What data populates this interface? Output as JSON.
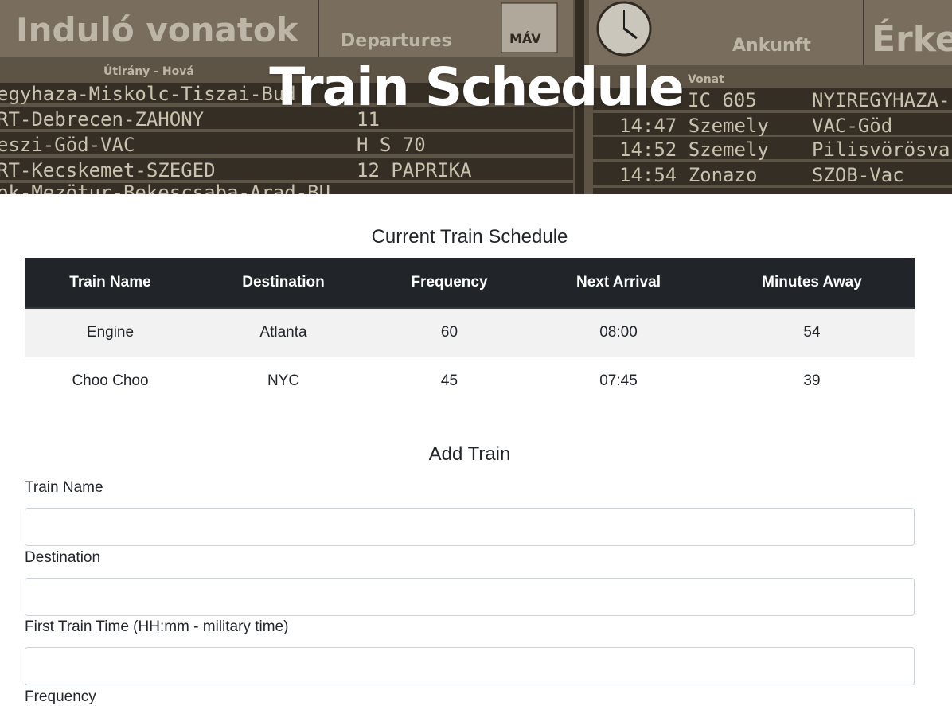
{
  "header": {
    "title": "Train Schedule",
    "board_texts": {
      "top_left_1": "Induló vonatok",
      "top_left_2": "Departures",
      "logo": "MÁV",
      "top_right_1": "Ankunft",
      "top_right_2": "Érkez",
      "sub_1": "Útirány - Hová",
      "sub_2": "Vonat",
      "row_l1": "egyhaza-Miskolc-Tiszai-Bud",
      "row_l2": "RT-Debrecen-ZAHONY",
      "row_l3": "eszi-Göd-VAC",
      "row_l4": "RT-Kecskemet-SZEGED",
      "row_l5": "ok-Mezötur-Bekescsaba-Arad-BU",
      "row_m2": "11",
      "row_m3": "H   S 70",
      "row_m4": "12  PAPRIKA",
      "row_r1": "IC 605",
      "row_r1b": "NYIREGYHAZA-",
      "row_r2": "14:47 Szemely",
      "row_r2b": "VAC-Göd",
      "row_r3": "14:52 Szemely",
      "row_r3b": "Pilisvörösvar",
      "row_r4": "14:54 Zonazo",
      "row_r4b": "SZOB-Vac"
    }
  },
  "schedule": {
    "title": "Current Train Schedule",
    "columns": [
      "Train Name",
      "Destination",
      "Frequency",
      "Next Arrival",
      "Minutes Away"
    ],
    "rows": [
      [
        "Engine",
        "Atlanta",
        "60",
        "08:00",
        "54"
      ],
      [
        "Choo Choo",
        "NYC",
        "45",
        "07:45",
        "39"
      ]
    ]
  },
  "add_train": {
    "title": "Add Train",
    "fields": [
      {
        "label": "Train Name",
        "value": ""
      },
      {
        "label": "Destination",
        "value": ""
      },
      {
        "label": "First Train Time (HH:mm - military time)",
        "value": ""
      },
      {
        "label": "Frequency",
        "value": ""
      }
    ]
  },
  "colors": {
    "table_header_bg": "#212529",
    "striped_row_bg": "#f2f2f2",
    "hero_tone": "#6e6352"
  }
}
